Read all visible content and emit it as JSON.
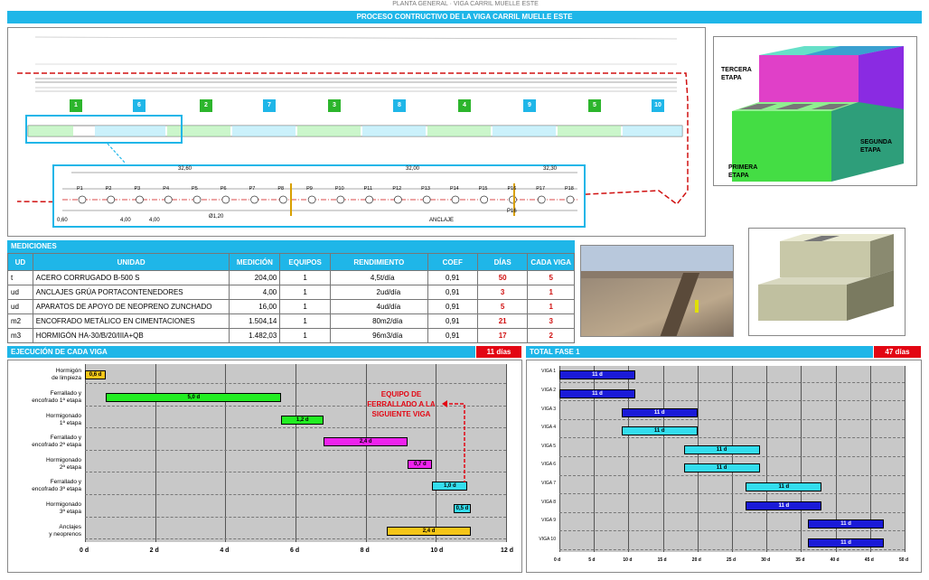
{
  "doc_header": "PLANTA GENERAL · VIGA CARRIL MUELLE ESTE",
  "title": "PROCESO CONTRUCTIVO DE LA VIGA CARRIL MUELLE ESTE",
  "plan": {
    "segments": [
      "1",
      "6",
      "2",
      "7",
      "3",
      "8",
      "4",
      "9",
      "5",
      "10"
    ],
    "piles": [
      "P1",
      "P2",
      "P3",
      "P4",
      "P5",
      "P6",
      "P7",
      "P8",
      "P9",
      "P10",
      "P11",
      "P12",
      "P13",
      "P14",
      "P15",
      "P16",
      "P17",
      "P18"
    ],
    "dims_top": [
      "32,60",
      "32,00",
      "32,30"
    ],
    "dims_bottom": [
      "0,60",
      "4,00",
      "4,00"
    ],
    "pile_dia": "Ø1,20",
    "anclaje": "ANCLAJE",
    "p_extra": "P16"
  },
  "stages": {
    "tercera": "TERCERA\nETAPA",
    "segunda": "SEGUNDA\nETAPA",
    "primera": "PRIMERA\nETAPA"
  },
  "mediciones": {
    "title": "MEDICIONES",
    "headers": [
      "UD",
      "UNIDAD",
      "MEDICIÓN",
      "EQUIPOS",
      "RENDIMIENTO",
      "COEF",
      "DÍAS",
      "CADA VIGA"
    ],
    "rows": [
      {
        "ud": "t",
        "unidad": "ACERO CORRUGADO B-500 S",
        "medicion": "204,00",
        "equipos": "1",
        "rend": "4,5",
        "rend_u": "t/día",
        "coef": "0,91",
        "dias": "50",
        "viga": "5"
      },
      {
        "ud": "ud",
        "unidad": "ANCLAJES GRÚA PORTACONTENEDORES",
        "medicion": "4,00",
        "equipos": "1",
        "rend": "2",
        "rend_u": "ud/día",
        "coef": "0,91",
        "dias": "3",
        "viga": "1"
      },
      {
        "ud": "ud",
        "unidad": "APARATOS DE APOYO DE NEOPRENO ZUNCHADO",
        "medicion": "16,00",
        "equipos": "1",
        "rend": "4",
        "rend_u": "ud/día",
        "coef": "0,91",
        "dias": "5",
        "viga": "1"
      },
      {
        "ud": "m2",
        "unidad": "ENCOFRADO METÁLICO EN CIMENTACIONES",
        "medicion": "1.504,14",
        "equipos": "1",
        "rend": "80",
        "rend_u": "m2/día",
        "coef": "0,91",
        "dias": "21",
        "viga": "3"
      },
      {
        "ud": "m3",
        "unidad": "HORMIGÓN HA-30/B/20/IIIA+QB",
        "medicion": "1.482,03",
        "equipos": "1",
        "rend": "96",
        "rend_u": "m3/día",
        "coef": "0,91",
        "dias": "17",
        "viga": "2"
      }
    ]
  },
  "ejecucion": {
    "title": "EJECUCIÓN DE CADA VIGA",
    "total": "11 días",
    "note": "EQUIPO DE\nFERRALLADO A LA\nSIGUIENTE VIGA",
    "ticks": [
      "0 d",
      "2 d",
      "4 d",
      "6 d",
      "8 d",
      "10 d",
      "12 d"
    ],
    "max": 12,
    "tasks": [
      {
        "label": "Hormigón\nde limpieza",
        "start": 0,
        "dur": 0.6,
        "text": "0,6 d",
        "color": "#f5c518"
      },
      {
        "label": "Ferrallado y\nencofrado 1ª etapa",
        "start": 0.6,
        "dur": 5.0,
        "text": "5,0 d",
        "color": "#22ee22"
      },
      {
        "label": "Hormigonado\n1ª etapa",
        "start": 5.6,
        "dur": 1.2,
        "text": "1,2 d",
        "color": "#22ee22"
      },
      {
        "label": "Ferrallado y\nencofrado 2ª etapa",
        "start": 6.8,
        "dur": 2.4,
        "text": "2,4 d",
        "color": "#ee22ee"
      },
      {
        "label": "Hormigonado\n2ª etapa",
        "start": 9.2,
        "dur": 0.7,
        "text": "0,7 d",
        "color": "#ee22ee"
      },
      {
        "label": "Ferrallado y\nencofrado 3ª etapa",
        "start": 9.9,
        "dur": 1.0,
        "text": "1,0 d",
        "color": "#33ddee"
      },
      {
        "label": "Hormigonado\n3ª etapa",
        "start": 10.5,
        "dur": 0.5,
        "text": "0,5 d",
        "color": "#33ddee"
      },
      {
        "label": "Anclajes\ny neoprenos",
        "start": 8.6,
        "dur": 2.4,
        "text": "2,4 d",
        "color": "#f5c518"
      }
    ]
  },
  "fase": {
    "title": "TOTAL FASE 1",
    "total": "47 días",
    "ticks": [
      "0 d",
      "5 d",
      "10 d",
      "15 d",
      "20 d",
      "25 d",
      "30 d",
      "35 d",
      "40 d",
      "45 d",
      "50 d"
    ],
    "max": 50,
    "tasks": [
      {
        "label": "VIGA 1",
        "start": 0,
        "dur": 11,
        "text": "11 d",
        "color": "#1a1ad8"
      },
      {
        "label": "VIGA 2",
        "start": 0,
        "dur": 11,
        "text": "11 d",
        "color": "#1a1ad8"
      },
      {
        "label": "VIGA 3",
        "start": 9,
        "dur": 11,
        "text": "11 d",
        "color": "#1a1ad8"
      },
      {
        "label": "VIGA 4",
        "start": 9,
        "dur": 11,
        "text": "11 d",
        "color": "#33ddee"
      },
      {
        "label": "VIGA 5",
        "start": 18,
        "dur": 11,
        "text": "11 d",
        "color": "#33ddee"
      },
      {
        "label": "VIGA 6",
        "start": 18,
        "dur": 11,
        "text": "11 d",
        "color": "#33ddee"
      },
      {
        "label": "VIGA 7",
        "start": 27,
        "dur": 11,
        "text": "11 d",
        "color": "#33ddee"
      },
      {
        "label": "VIGA 8",
        "start": 27,
        "dur": 11,
        "text": "11 d",
        "color": "#1a1ad8"
      },
      {
        "label": "VIGA 9",
        "start": 36,
        "dur": 11,
        "text": "11 d",
        "color": "#1a1ad8"
      },
      {
        "label": "VIGA 10",
        "start": 36,
        "dur": 11,
        "text": "11 d",
        "color": "#1a1ad8"
      }
    ]
  }
}
